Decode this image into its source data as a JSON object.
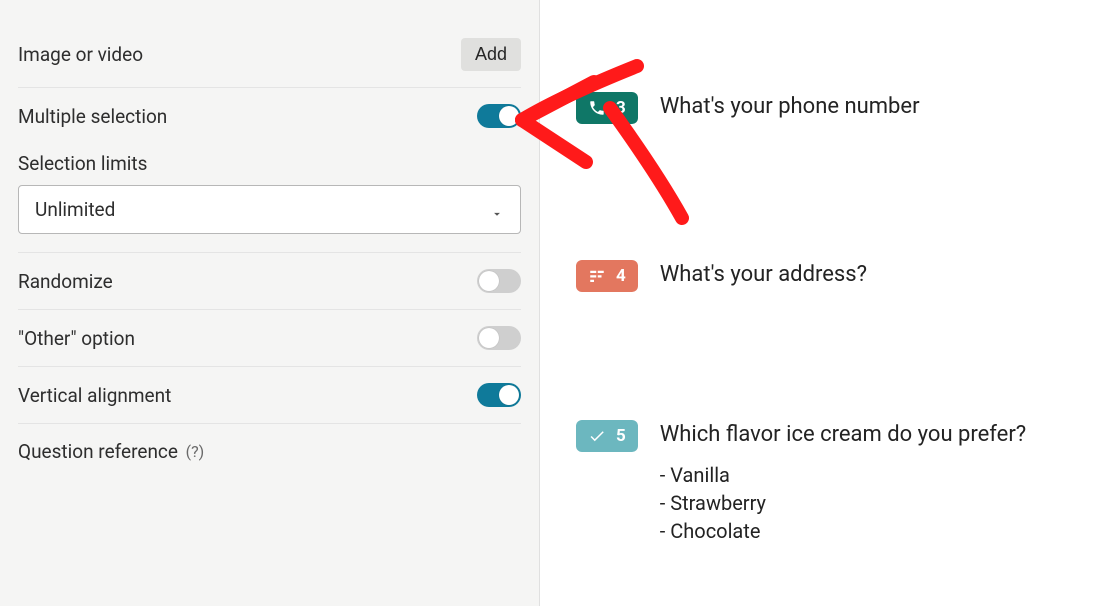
{
  "sidebar": {
    "image_or_video_label": "Image or video",
    "add_label": "Add",
    "multiple_selection_label": "Multiple selection",
    "multiple_selection_on": true,
    "selection_limits_label": "Selection limits",
    "selection_limits_value": "Unlimited",
    "randomize_label": "Randomize",
    "randomize_on": false,
    "other_option_label": "\"Other\" option",
    "other_option_on": false,
    "vertical_alignment_label": "Vertical alignment",
    "vertical_alignment_on": true,
    "question_reference_label": "Question reference",
    "question_reference_help": "(?)"
  },
  "content": {
    "questions": [
      {
        "number": "3",
        "title": "What's your phone number",
        "color": "#0f7767",
        "icon": "phone"
      },
      {
        "number": "4",
        "title": "What's your address?",
        "color": "#e3775f",
        "icon": "address"
      },
      {
        "number": "5",
        "title": "Which flavor ice cream do you prefer?",
        "color": "#6cb7bf",
        "icon": "check",
        "options": [
          "- Vanilla",
          "- Strawberry",
          "- Chocolate"
        ]
      }
    ]
  }
}
